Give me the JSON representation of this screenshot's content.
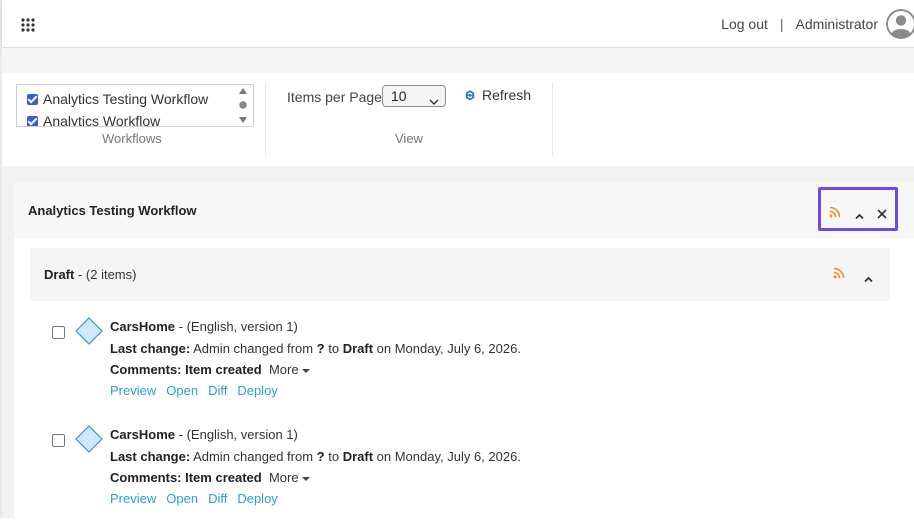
{
  "header": {
    "logout": "Log out",
    "separator": "|",
    "user": "Administrator"
  },
  "toolbar": {
    "workflows": [
      "Analytics Testing Workflow",
      "Analytics Workflow"
    ],
    "workflows_label": "Workflows",
    "items_per_page_label": "Items per Page:",
    "items_per_page_value": "10",
    "refresh_label": "Refresh",
    "view_label": "View"
  },
  "panel": {
    "title": "Analytics Testing Workflow",
    "state": {
      "name": "Draft",
      "count": " - (2 items)"
    },
    "items": [
      {
        "name": "CarsHome",
        "meta": " - (English, version 1)",
        "last_change_label": "Last change:",
        "change_pre": " Admin changed from ",
        "from_state": "?",
        "change_mid": " to ",
        "to_state": "Draft",
        "change_post": " on Monday, July 6, 2026.",
        "comments_label": "Comments: Item created",
        "more": "More",
        "actions": [
          "Preview",
          "Open",
          "Diff",
          "Deploy"
        ]
      },
      {
        "name": "CarsHome",
        "meta": " - (English, version 1)",
        "last_change_label": "Last change:",
        "change_pre": " Admin changed from ",
        "from_state": "?",
        "change_mid": " to ",
        "to_state": "Draft",
        "change_post": " on Monday, July 6, 2026.",
        "comments_label": "Comments: Item created",
        "more": "More",
        "actions": [
          "Preview",
          "Open",
          "Diff",
          "Deploy"
        ]
      }
    ]
  },
  "colors": {
    "accent_link": "#2a9fd6",
    "rss": "#f08a24",
    "highlight": "#7047e8",
    "checkbox": "#3b5bdb",
    "diamond": "#cfe8fb"
  },
  "icons": [
    "apps-grid-icon",
    "user-avatar-icon",
    "refresh-icon",
    "rss-icon",
    "collapse-icon",
    "close-icon",
    "content-diamond-icon"
  ]
}
